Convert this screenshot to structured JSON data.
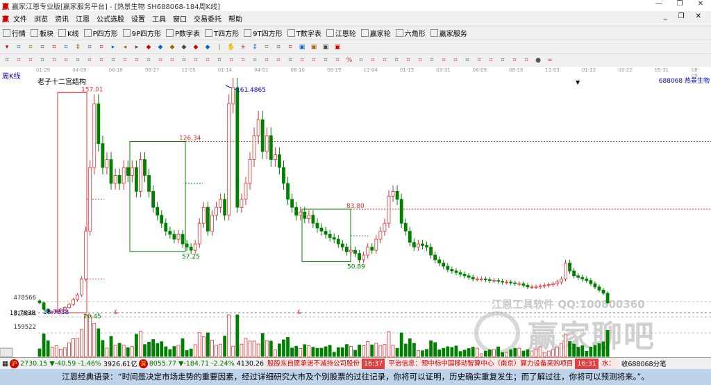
{
  "window": {
    "title": "赢家江恩专业版[赢家服务平台] - [热景生物  SH688068-184周K线]",
    "logo": "赢"
  },
  "menu": [
    "文件",
    "浏览",
    "资讯",
    "江恩",
    "公式选股",
    "设置",
    "工具",
    "窗口",
    "交易委托",
    "帮助"
  ],
  "toolbar1": [
    {
      "icon": "grid-icon",
      "label": "行情"
    },
    {
      "icon": "blocks-icon",
      "label": "板块"
    },
    {
      "icon": "kline-icon",
      "label": "K线"
    },
    {
      "icon": "ps-icon",
      "label": "P四方形"
    },
    {
      "icon": "p9-icon",
      "label": "9P四方形"
    },
    {
      "icon": "pn-icon",
      "label": "P数字表"
    },
    {
      "icon": "ts-icon",
      "label": "T四方形"
    },
    {
      "icon": "t9-icon",
      "label": "9T四方形"
    },
    {
      "icon": "tn-icon",
      "label": "T数字表"
    },
    {
      "icon": "target-icon",
      "label": "江恩轮"
    },
    {
      "icon": "wheel-icon",
      "label": "赢家轮"
    },
    {
      "icon": "hexagon-icon",
      "label": "六角形"
    },
    {
      "icon": "dollar-icon",
      "label": "赢家服务"
    }
  ],
  "chart": {
    "period_label": "周K线",
    "study_label": "老子十二宫结构",
    "stock_label": "688068 热景生物",
    "dates": [
      "01-29",
      "04-09",
      "06-18",
      "08-27",
      "11-05",
      "01-14",
      "04-01",
      "06-10",
      "08-19",
      "11-04",
      "01-13",
      "03-31",
      "06-09",
      "08-18",
      "11-03",
      "01-12",
      "03-22",
      "05-31",
      "08-09"
    ],
    "annotations": {
      "high1": "157.01",
      "peak": "161.4865",
      "level1": "126.34",
      "level2": "83.80",
      "low1": "57.25",
      "low2": "50.89",
      "start": "18.7838",
      "start_blue": "18.7838",
      "green_start": "20.45",
      "dollar": "$"
    },
    "volume_labels": [
      "478566",
      "319044",
      "159522"
    ],
    "watermark1": "江恩工具软件  QQ:100800360",
    "watermark2": "赢家聊吧"
  },
  "chart_data": {
    "type": "candlestick",
    "title": "热景生物 SH688068 周K线",
    "price_range": [
      18.7838,
      161.4865
    ],
    "closes": [
      25,
      21,
      19,
      19.5,
      20,
      21,
      22,
      24,
      27,
      30,
      40,
      70,
      110,
      150,
      125,
      110,
      115,
      100,
      105,
      100,
      110,
      105,
      110,
      95,
      115,
      105,
      95,
      85,
      80,
      75,
      70,
      68,
      65,
      68,
      62,
      60,
      58,
      62,
      75,
      85,
      70,
      80,
      85,
      90,
      80,
      150,
      160,
      85,
      90,
      100,
      115,
      130,
      140,
      120,
      130,
      115,
      118,
      110,
      100,
      90,
      85,
      80,
      82,
      78,
      80,
      75,
      72,
      70,
      68,
      66,
      65,
      62,
      60,
      57,
      58,
      56,
      52,
      55,
      60,
      58,
      65,
      70,
      75,
      92,
      95,
      90,
      75,
      70,
      63,
      60,
      62,
      61,
      60,
      55,
      52,
      50,
      48,
      46,
      45,
      44,
      43,
      42,
      41,
      40,
      40,
      40,
      39.5,
      39,
      39,
      38.5,
      38,
      38,
      37.5,
      37,
      37,
      36,
      35,
      35,
      35,
      35.5,
      36,
      36.5,
      37,
      38,
      40,
      50,
      45,
      42,
      41,
      40,
      39,
      37,
      35,
      33,
      31,
      25
    ]
  },
  "status": {
    "sh_icon": "沪",
    "sh": "2730.15",
    "sh_chg": "▼-40.59",
    "sh_pct": "-1.46%",
    "sh_amt": "3926.61亿",
    "sz_icon": "深",
    "sz": "8055.77",
    "sz_chg": "▼-184.71",
    "sz_pct": "-2.24%",
    "sz_amt": "4130.26",
    "news1": "股股东自愿承诺不减持公司股份",
    "time1": "16:37",
    "news2": "平治信息：预中标中国移动智算中心（南京）算力设备采购项目",
    "time2": "16:31",
    "news3": "水：",
    "right": "收688068分笔"
  },
  "quote": "江恩经典语录：“时间是决定市场走势的重要因素，经过详细研究大市及个别股票的过往记录，你将可以证明，历史确实重复发生；而了解过往，你将可以预测将来。”。",
  "colors": {
    "up": "#e03030",
    "down": "#008000",
    "blue": "#0000c0"
  }
}
